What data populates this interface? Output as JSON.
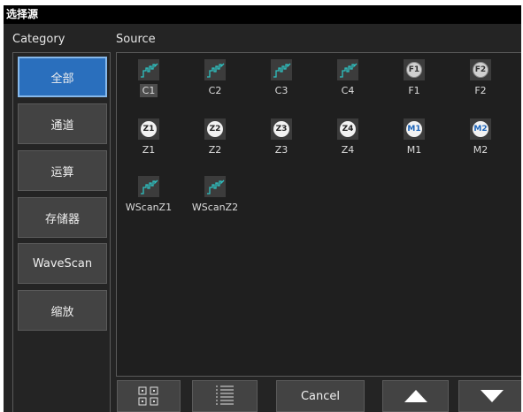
{
  "title": "选择源",
  "headers": {
    "category": "Category",
    "source": "Source"
  },
  "categories": [
    {
      "label": "全部",
      "selected": true
    },
    {
      "label": "通道",
      "selected": false
    },
    {
      "label": "运算",
      "selected": false
    },
    {
      "label": "存储器",
      "selected": false
    },
    {
      "label": "WaveScan",
      "selected": false
    },
    {
      "label": "缩放",
      "selected": false
    }
  ],
  "sources": [
    {
      "label": "C1",
      "icon": "waveform-icon",
      "highlight": true
    },
    {
      "label": "C2",
      "icon": "waveform-icon"
    },
    {
      "label": "C3",
      "icon": "waveform-icon"
    },
    {
      "label": "C4",
      "icon": "waveform-icon"
    },
    {
      "label": "F1",
      "icon": "function-badge-icon",
      "badge": "F1"
    },
    {
      "label": "F2",
      "icon": "function-badge-icon",
      "badge": "F2"
    },
    {
      "label": "Z1",
      "icon": "zoom-badge-icon",
      "badge": "Z1"
    },
    {
      "label": "Z2",
      "icon": "zoom-badge-icon",
      "badge": "Z2"
    },
    {
      "label": "Z3",
      "icon": "zoom-badge-icon",
      "badge": "Z3"
    },
    {
      "label": "Z4",
      "icon": "zoom-badge-icon",
      "badge": "Z4"
    },
    {
      "label": "M1",
      "icon": "memory-badge-icon",
      "badge": "M1"
    },
    {
      "label": "M2",
      "icon": "memory-badge-icon",
      "badge": "M2"
    },
    {
      "label": "WScanZ1",
      "icon": "waveform-icon"
    },
    {
      "label": "WScanZ2",
      "icon": "waveform-icon"
    }
  ],
  "buttons": {
    "grid_view": "grid-view-icon",
    "list_view": "list-view-icon",
    "cancel": "Cancel",
    "scroll_up": "arrow-up-icon",
    "scroll_down": "arrow-down-icon"
  },
  "colors": {
    "dialog_bg": "#242424",
    "selected_category": "#2a6fbd",
    "waveform": "#2ec2c2",
    "memory_badge": "#1b63b8"
  }
}
